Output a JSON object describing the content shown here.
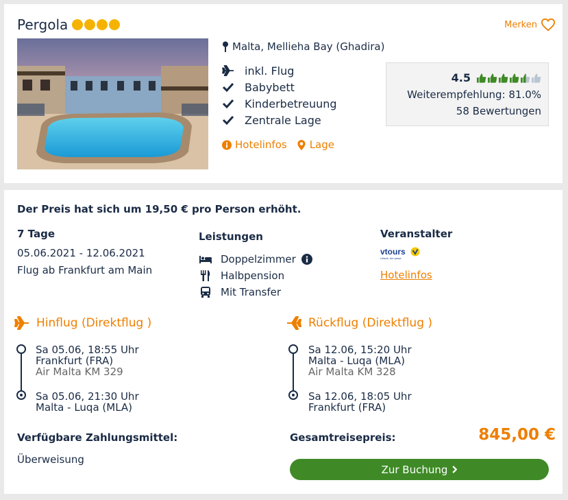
{
  "hotel": {
    "name": "Pergola",
    "stars": 4,
    "merken_label": "Merken",
    "location": "Malta, Mellieha Bay (Ghadira)",
    "features": [
      "inkl. Flug",
      "Babybett",
      "Kinderbetreuung",
      "Zentrale Lage"
    ],
    "links": [
      "Hotelinfos",
      "Lage"
    ],
    "rating": {
      "score": "4.5",
      "score_value": 4.5,
      "recommendation": "Weiterempfehlung: 81.0%",
      "reviews": "58 Bewertungen"
    }
  },
  "offer": {
    "price_note": "Der Preis hat sich um 19,50 € pro Person erhöht.",
    "duration": "7 Tage",
    "dates": "05.06.2021 - 12.06.2021",
    "departure": "Flug ab Frankfurt am Main",
    "leistungen_label": "Leistungen",
    "leistungen": [
      "Doppelzimmer",
      "Halbpension",
      "Mit Transfer"
    ],
    "veranstalter_label": "Veranstalter",
    "veranstalter_logo": "vtours",
    "veranstalter_tagline": "Urlaub, der passt",
    "veranstalter_link": "Hotelinfos"
  },
  "flights": {
    "outbound": {
      "title": "Hinflug (Direktflug )",
      "dep_time": "Sa 05.06, 18:55 Uhr",
      "dep_airport": "Frankfurt (FRA)",
      "carrier": "Air Malta KM 329",
      "arr_time": "Sa 05.06, 21:30 Uhr",
      "arr_airport": "Malta - Luqa (MLA)"
    },
    "return": {
      "title": "Rückflug (Direktflug )",
      "dep_time": "Sa 12.06, 15:20 Uhr",
      "dep_airport": "Malta - Luqa (MLA)",
      "carrier": "Air Malta KM 328",
      "arr_time": "Sa 12.06, 18:05 Uhr",
      "arr_airport": "Frankfurt (FRA)"
    }
  },
  "payment": {
    "label": "Verfügbare Zahlungsmittel:",
    "method": "Überweisung"
  },
  "total": {
    "label": "Gesamtreisepreis:",
    "price": "845,00 €"
  },
  "booking_button": "Zur Buchung",
  "colors": {
    "accent": "#ee7f00",
    "navy": "#1a2b45",
    "green": "#3f8a27",
    "star": "#f5b300"
  }
}
